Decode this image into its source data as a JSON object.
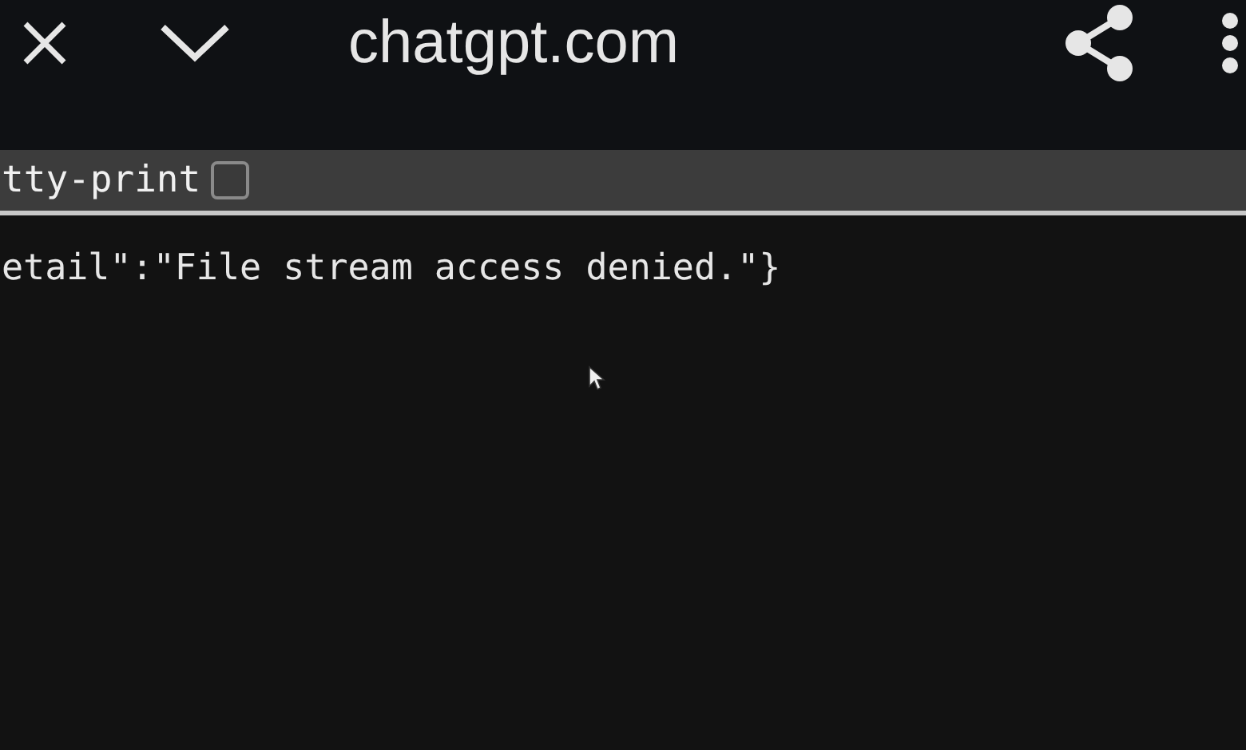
{
  "toolbar": {
    "title": "chatgpt.com"
  },
  "pretty_print": {
    "label": "tty-print",
    "checked": false
  },
  "content": {
    "text": "etail\":\"File stream access denied.\"}"
  }
}
